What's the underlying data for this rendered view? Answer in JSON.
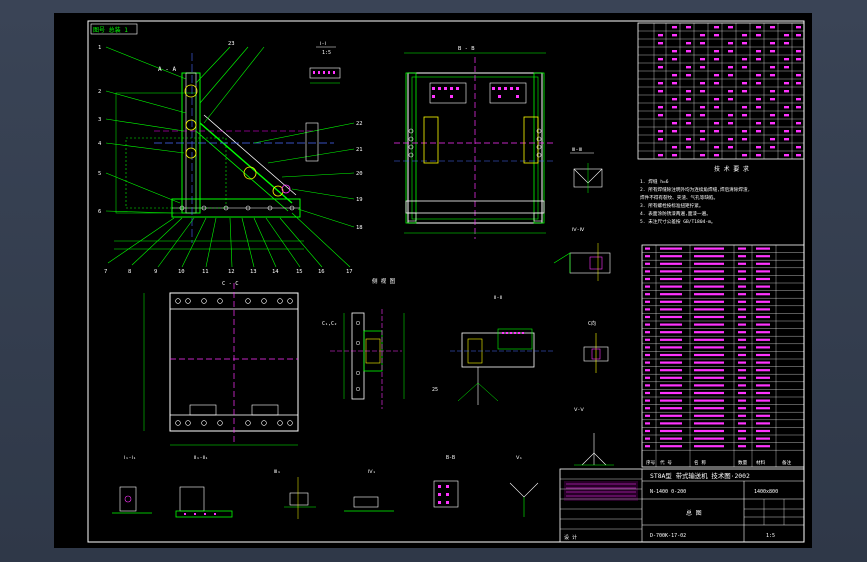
{
  "sheet": {
    "title_block": {
      "main_title": "ST8A型 带式输送机 技术图·2002",
      "row2_left": "N-1400 0-200",
      "row2_right": "1400x800",
      "bottom_left": "设 计",
      "drawing_no": "D-700K-17-02",
      "scale": "1:5",
      "designer_cn": "总 图"
    },
    "view_labels": {
      "a_a": "A - A",
      "b_b": "B - B",
      "c_c": "C - C",
      "top": "俯 视 图",
      "side": "侧 视 图",
      "detail1": "ⅠⅡ-Ⅱ",
      "detail2": "Ⅲ-Ⅲ",
      "detail3": "Ⅳ-Ⅳ",
      "detail4": "Ⅴ-Ⅴ"
    },
    "notes_title": "技 术 要 求",
    "notes": [
      "1. 焊缝 h=6",
      "2. 所有焊缝除注明外均为连续角焊缝,焊后清除焊渣,",
      "   焊件不得有裂纹、夹渣、气孔等缺陷。",
      "3. 所有螺栓按标准扭矩拧紧。",
      "4. 表面涂防锈漆两遍,面漆一遍。",
      "5. 未注尺寸公差按 GB/T1804-m。"
    ],
    "corner_tag": "图号 总装 1",
    "bom_headers": [
      "序号",
      "代 号",
      "名 称",
      "数量",
      "材料",
      "备注"
    ],
    "callout_numbers": [
      "1",
      "2",
      "3",
      "4",
      "5",
      "6",
      "7",
      "8",
      "9",
      "10",
      "11",
      "12",
      "13",
      "14",
      "15",
      "16",
      "17",
      "18",
      "19",
      "20",
      "21",
      "22",
      "23"
    ]
  }
}
